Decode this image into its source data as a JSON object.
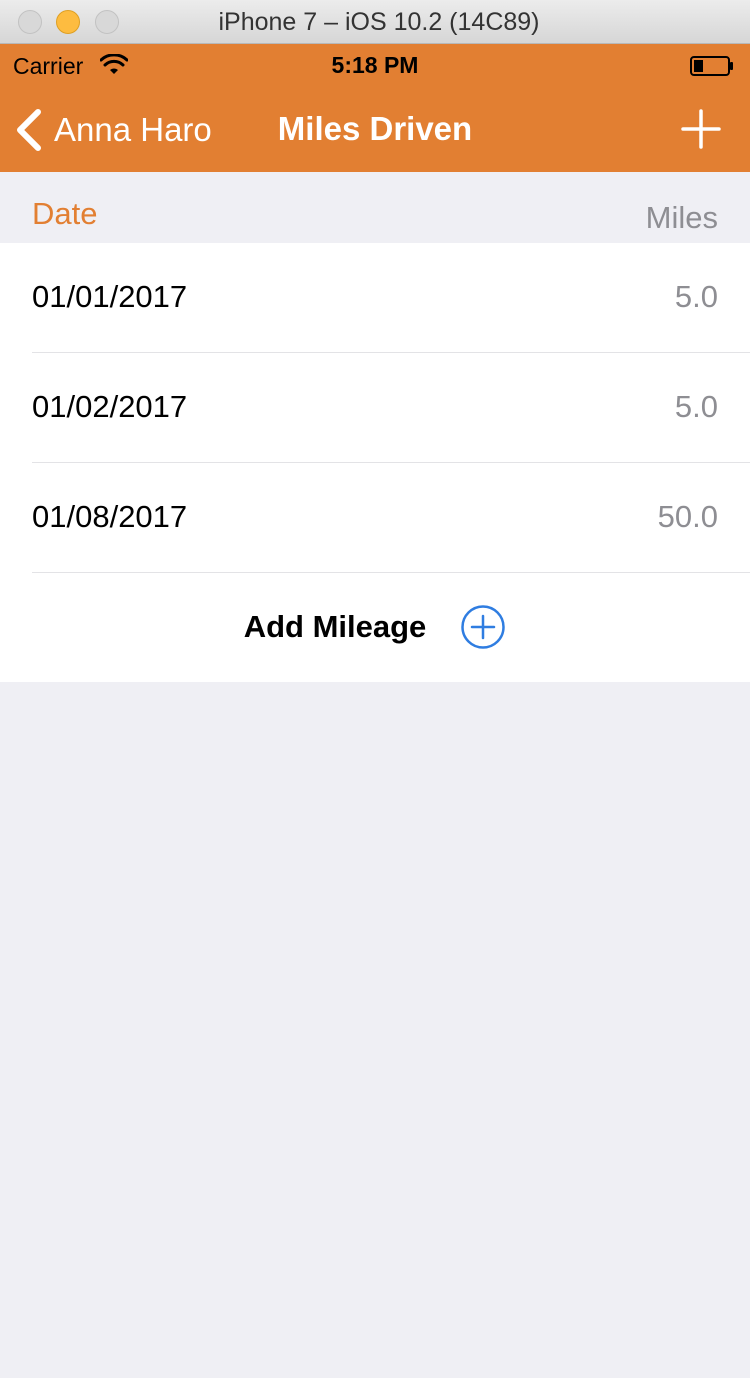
{
  "window": {
    "title": "iPhone 7 – iOS 10.2 (14C89)"
  },
  "status_bar": {
    "carrier": "Carrier",
    "time": "5:18 PM",
    "wifi_icon": "wifi-icon",
    "battery_icon": "battery-low-icon"
  },
  "nav": {
    "back_label": "Anna Haro",
    "title": "Miles Driven",
    "add_icon": "plus-icon",
    "accent_color": "#e27f32"
  },
  "table": {
    "header_date": "Date",
    "header_miles": "Miles",
    "rows": [
      {
        "date": "01/01/2017",
        "miles": "5.0"
      },
      {
        "date": "01/02/2017",
        "miles": "5.0"
      },
      {
        "date": "01/08/2017",
        "miles": "50.0"
      }
    ],
    "add_label": "Add Mileage",
    "add_icon": "plus-circle-icon",
    "add_icon_color": "#2f7de1"
  }
}
